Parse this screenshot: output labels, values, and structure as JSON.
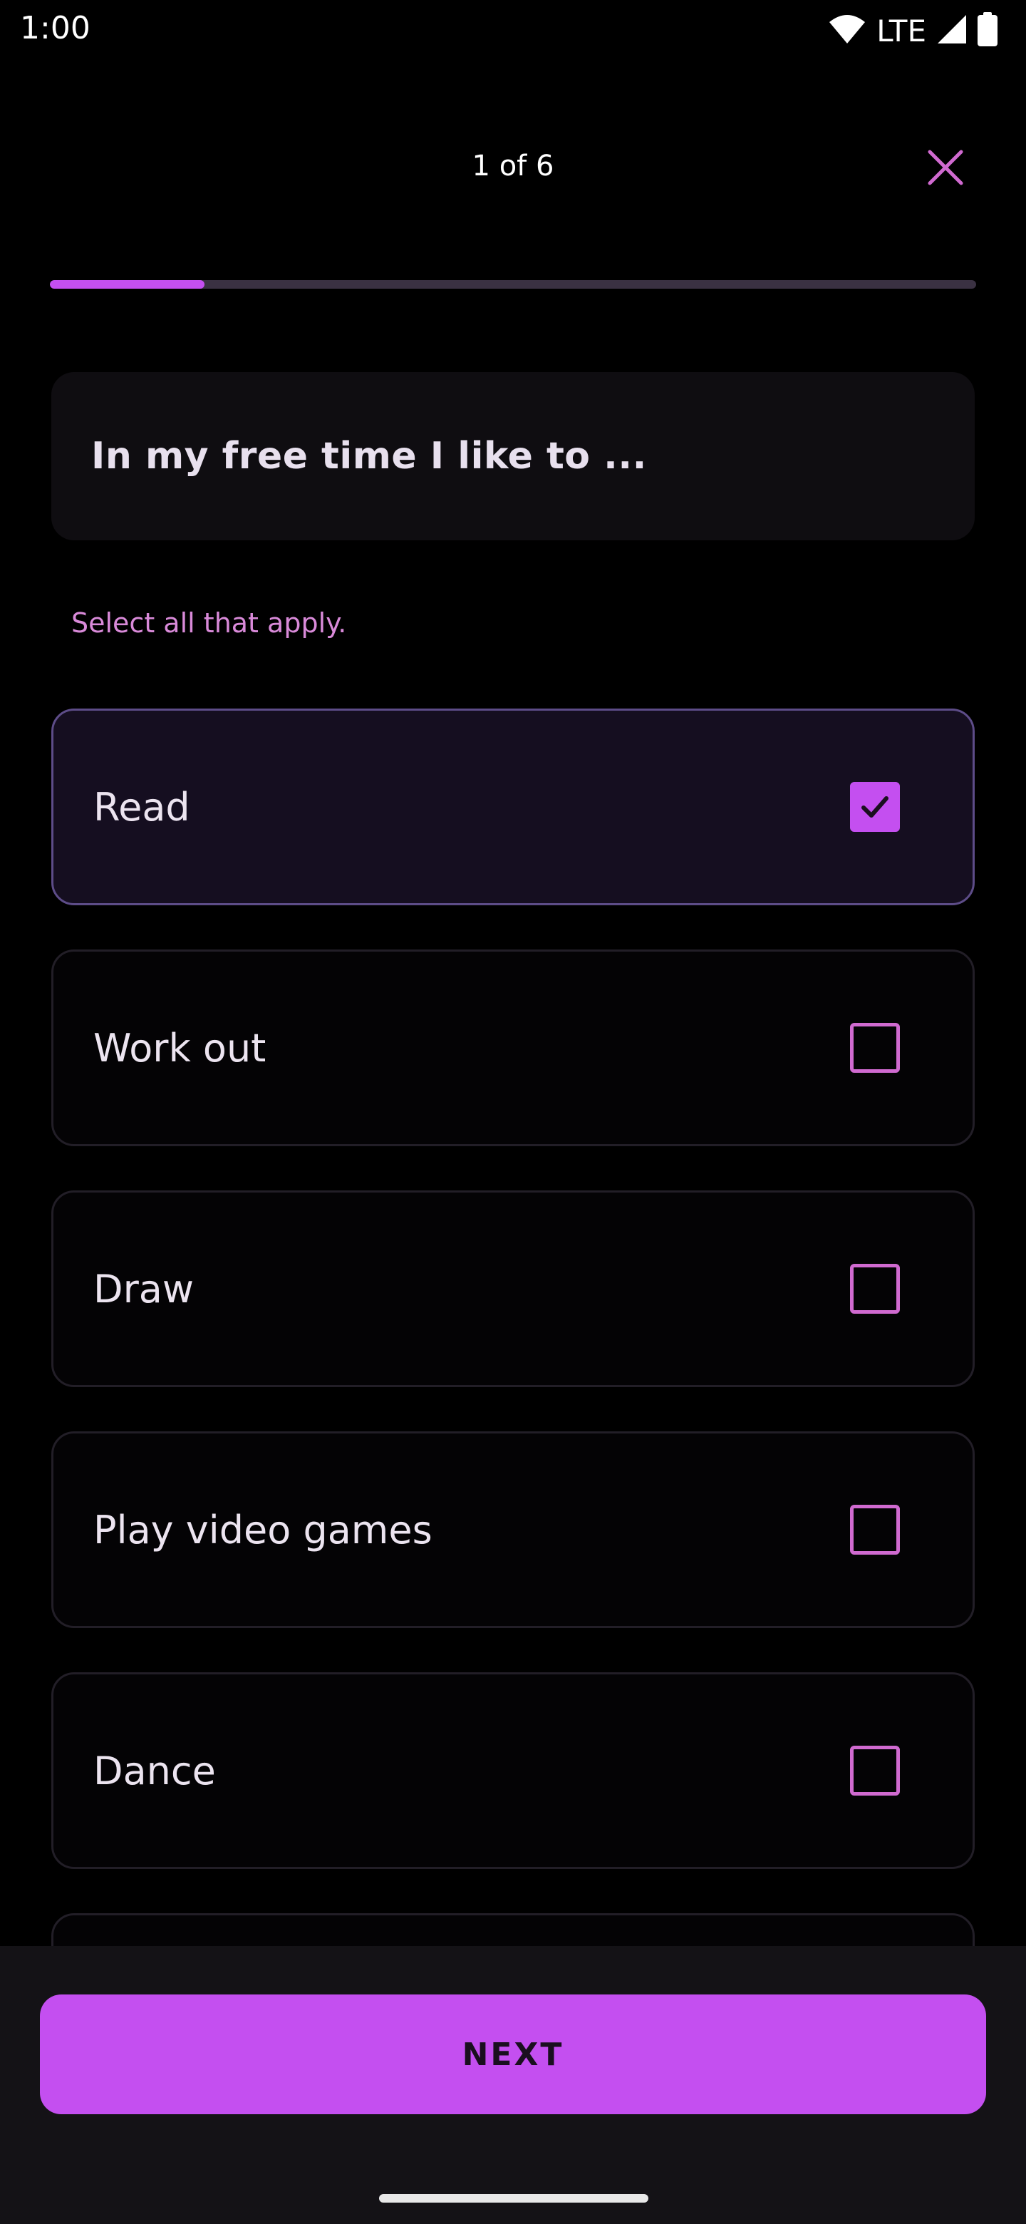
{
  "status_bar": {
    "time": "1:00",
    "network": "LTE",
    "icons": [
      "wifi-icon",
      "signal-icon",
      "battery-icon"
    ]
  },
  "header": {
    "step": "1 of 6",
    "close_icon": "close-icon"
  },
  "progress": {
    "current": 1,
    "total": 6,
    "fraction": 0.167
  },
  "question": {
    "text": "In my free time I like to ...",
    "instruction": "Select all that apply."
  },
  "options": [
    {
      "label": "Read",
      "checked": true
    },
    {
      "label": "Work out",
      "checked": false
    },
    {
      "label": "Draw",
      "checked": false
    },
    {
      "label": "Play video games",
      "checked": false
    },
    {
      "label": "Dance",
      "checked": false
    }
  ],
  "footer": {
    "next_label": "NEXT"
  },
  "colors": {
    "accent": "#c44ff0",
    "close_icon": "#d06ad0",
    "instruction": "#d98ad9",
    "selected_border": "#5d4c88"
  }
}
